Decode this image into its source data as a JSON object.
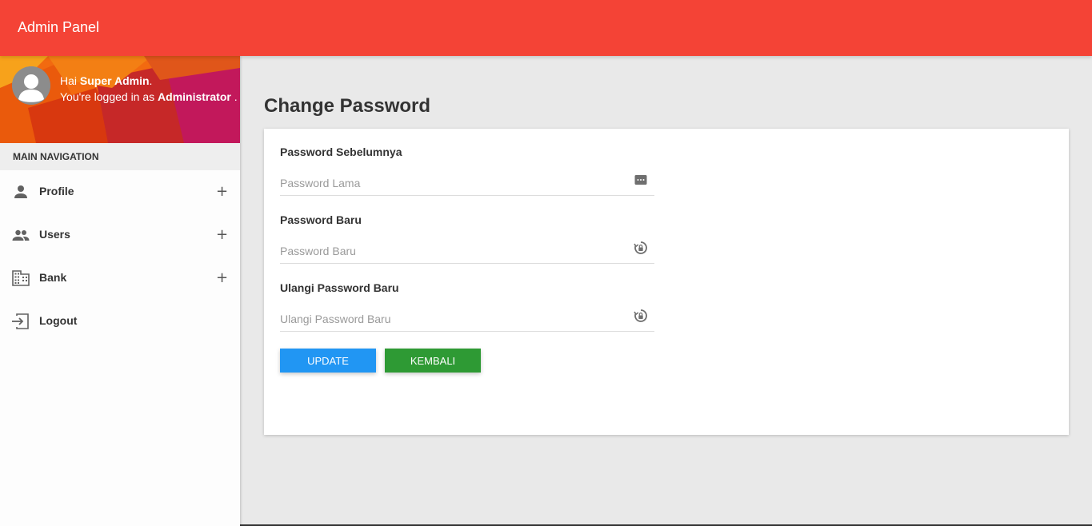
{
  "app": {
    "brand": "Admin Panel"
  },
  "user": {
    "greeting_prefix": "Hai",
    "name": "Super Admin",
    "name_suffix": ".",
    "role_prefix": "You're logged in as",
    "role": "Administrator",
    "role_suffix": "."
  },
  "sidebar": {
    "header": "MAIN NAVIGATION",
    "items": [
      {
        "label": "Profile",
        "icon": "person-icon",
        "expand": "+"
      },
      {
        "label": "Users",
        "icon": "people-icon",
        "expand": "+"
      },
      {
        "label": "Bank",
        "icon": "building-icon",
        "expand": "+"
      },
      {
        "label": "Logout",
        "icon": "logout-icon"
      }
    ]
  },
  "page": {
    "title": "Change Password"
  },
  "form": {
    "old_password": {
      "label": "Password Sebelumnya",
      "placeholder": "Password Lama",
      "value": "",
      "icon": "password-dots-icon"
    },
    "new_password": {
      "label": "Password Baru",
      "placeholder": "Password Baru",
      "value": "",
      "icon": "lock-reset-icon"
    },
    "confirm_password": {
      "label": "Ulangi Password Baru",
      "placeholder": "Ulangi Password Baru",
      "value": "",
      "icon": "lock-reset-icon"
    },
    "update_label": "UPDATE",
    "back_label": "KEMBALI"
  },
  "colors": {
    "topbar": "#f44336",
    "update_button": "#2196f3",
    "back_button": "#2e9a34"
  }
}
